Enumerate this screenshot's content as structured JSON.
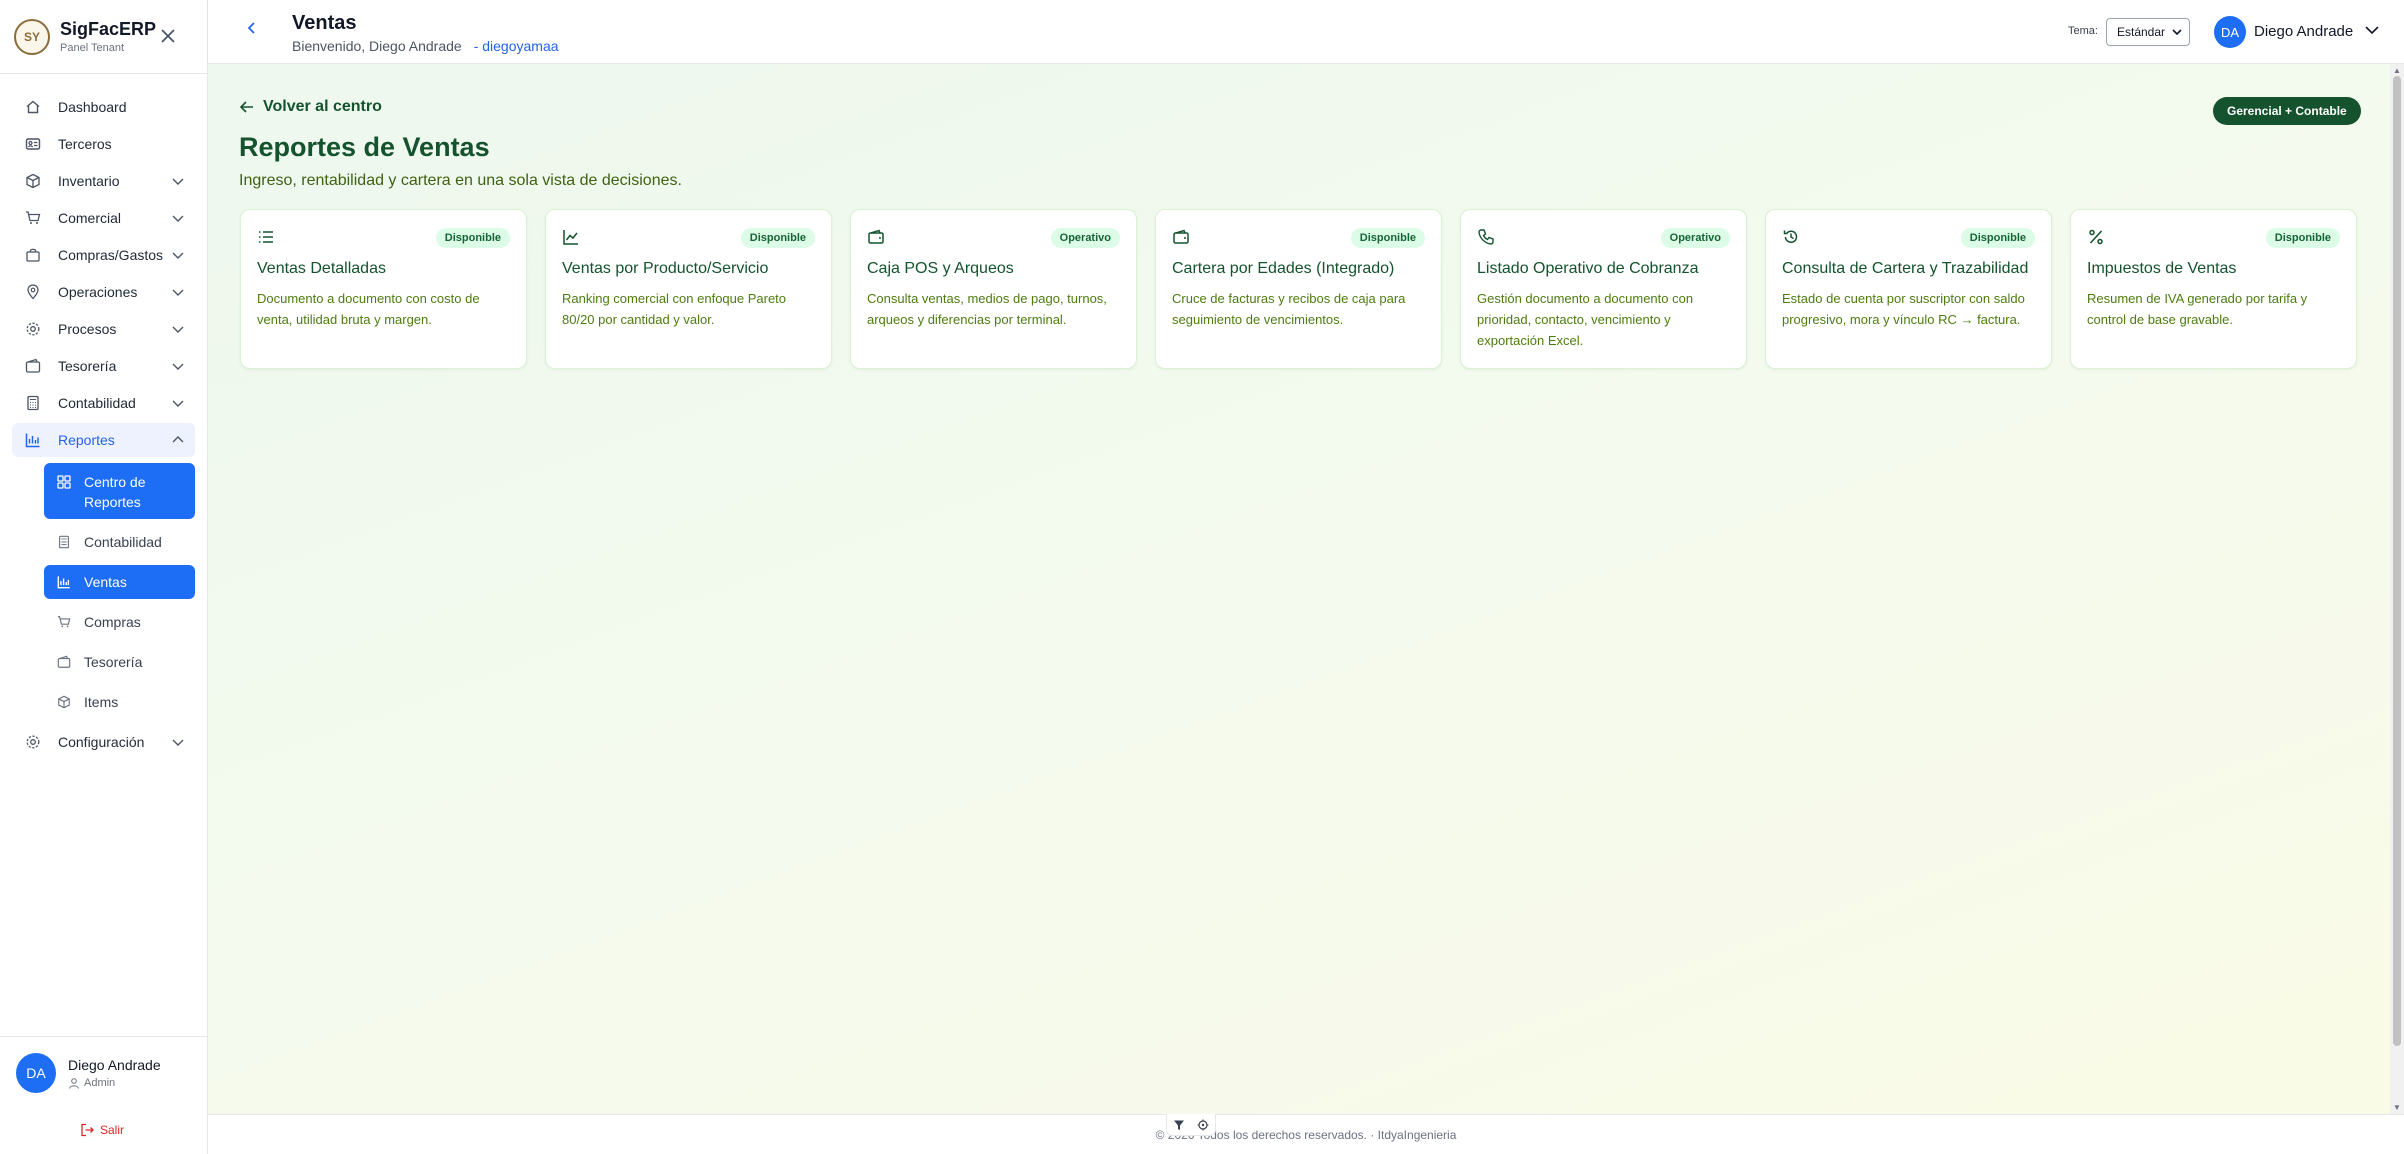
{
  "sidebar": {
    "brand_name": "SigFacERP",
    "brand_sub": "Panel Tenant",
    "logo_text": "SY",
    "items": [
      {
        "label": "Dashboard",
        "icon": "home-icon"
      },
      {
        "label": "Terceros",
        "icon": "id-card-icon"
      },
      {
        "label": "Inventario",
        "icon": "box-icon"
      },
      {
        "label": "Comercial",
        "icon": "cart-icon"
      },
      {
        "label": "Compras/Gastos",
        "icon": "bag-icon"
      },
      {
        "label": "Operaciones",
        "icon": "location-icon"
      },
      {
        "label": "Procesos",
        "icon": "gear-icon"
      },
      {
        "label": "Tesorería",
        "icon": "wallet-icon"
      },
      {
        "label": "Contabilidad",
        "icon": "calculator-icon"
      },
      {
        "label": "Reportes",
        "icon": "bar-chart-icon"
      },
      {
        "label": "Configuración",
        "icon": "gear-icon"
      }
    ],
    "sub_items": [
      {
        "label": "Centro de Reportes",
        "icon": "grid-icon"
      },
      {
        "label": "Contabilidad",
        "icon": "calculator-icon"
      },
      {
        "label": "Ventas",
        "icon": "bar-chart-icon"
      },
      {
        "label": "Compras",
        "icon": "cart-icon"
      },
      {
        "label": "Tesorería",
        "icon": "wallet-icon"
      },
      {
        "label": "Items",
        "icon": "box-icon"
      }
    ],
    "user_initials": "DA",
    "user_name": "Diego Andrade",
    "user_role": "Admin",
    "logout_label": "Salir"
  },
  "header": {
    "title": "Ventas",
    "welcome": "Bienvenido, Diego Andrade",
    "username": "- diegoyamaa",
    "tema_label": "Tema:",
    "tema_value": "Estándar",
    "user_initials": "DA",
    "user_name": "Diego Andrade"
  },
  "main": {
    "back_label": "Volver al centro",
    "badge": "Gerencial + Contable",
    "title": "Reportes de Ventas",
    "description": "Ingreso, rentabilidad y cartera en una sola vista de decisiones.",
    "cards": [
      {
        "icon": "list-icon",
        "badge": "Disponible",
        "title": "Ventas Detalladas",
        "desc": "Documento a documento con costo de venta, utilidad bruta y margen."
      },
      {
        "icon": "trend-chart-icon",
        "badge": "Disponible",
        "title": "Ventas por Producto/Servicio",
        "desc": "Ranking comercial con enfoque Pareto 80/20 por cantidad y valor."
      },
      {
        "icon": "wallet-icon",
        "badge": "Operativo",
        "title": "Caja POS y Arqueos",
        "desc": "Consulta ventas, medios de pago, turnos, arqueos y diferencias por terminal."
      },
      {
        "icon": "wallet-icon",
        "badge": "Disponible",
        "title": "Cartera por Edades (Integrado)",
        "desc": "Cruce de facturas y recibos de caja para seguimiento de vencimientos."
      },
      {
        "icon": "phone-icon",
        "badge": "Operativo",
        "title": "Listado Operativo de Cobranza",
        "desc": "Gestión documento a documento con prioridad, contacto, vencimiento y exportación Excel."
      },
      {
        "icon": "history-icon",
        "badge": "Disponible",
        "title": "Consulta de Cartera y Trazabilidad",
        "desc": "Estado de cuenta por suscriptor con saldo progresivo, mora y vínculo RC → factura."
      },
      {
        "icon": "percent-icon",
        "badge": "Disponible",
        "title": "Impuestos de Ventas",
        "desc": "Resumen de IVA generado por tarifa y control de base gravable."
      }
    ]
  },
  "footer": {
    "text": "© 2026 Todos los derechos reservados. · ItdyaIngenieria"
  }
}
